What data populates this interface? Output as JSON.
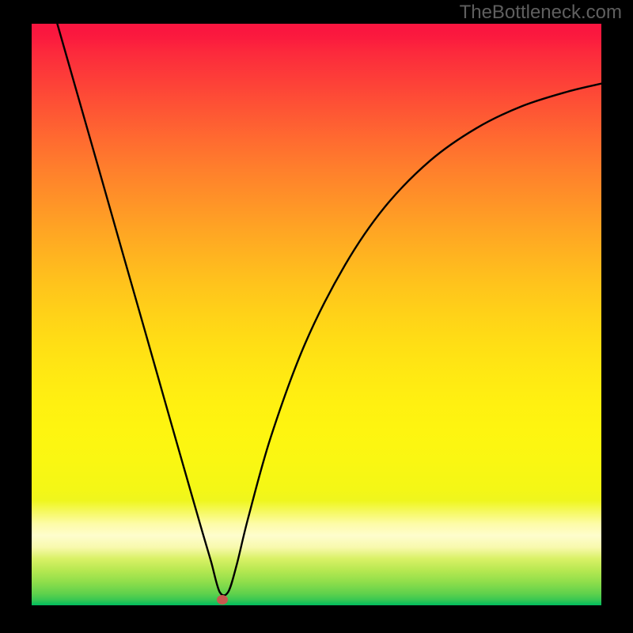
{
  "attribution": "TheBottleneck.com",
  "marker": {
    "color": "#C8594F",
    "x_pct": 33.5,
    "y_pct": 99.1
  },
  "chart_data": {
    "type": "line",
    "title": "",
    "xlabel": "",
    "ylabel": "",
    "xlim": [
      0,
      100
    ],
    "ylim": [
      0,
      100
    ],
    "grid": false,
    "legend": false,
    "series": [
      {
        "name": "curve",
        "x": [
          4.5,
          8,
          12,
          16,
          20,
          24,
          28,
          30,
          31.5,
          33,
          34.5,
          36,
          38,
          42,
          48,
          55,
          62,
          70,
          78,
          86,
          94,
          100
        ],
        "y": [
          100,
          88,
          74.3,
          60.5,
          46.8,
          33,
          19.3,
          12.5,
          7.5,
          2.3,
          2.3,
          7,
          15,
          29,
          45,
          58.5,
          68.5,
          76.5,
          82,
          85.8,
          88.3,
          89.7
        ]
      }
    ],
    "background_gradient": {
      "orientation": "vertical",
      "stops": [
        {
          "pct": 0,
          "color": "#FA163F"
        },
        {
          "pct": 25,
          "color": "#FF7F2C"
        },
        {
          "pct": 50,
          "color": "#FFD218"
        },
        {
          "pct": 80,
          "color": "#F4F716"
        },
        {
          "pct": 100,
          "color": "#00BD5E"
        }
      ]
    },
    "marker_point": {
      "x_pct": 33.5,
      "y_pct": 0.9,
      "color": "#C8594F"
    }
  }
}
